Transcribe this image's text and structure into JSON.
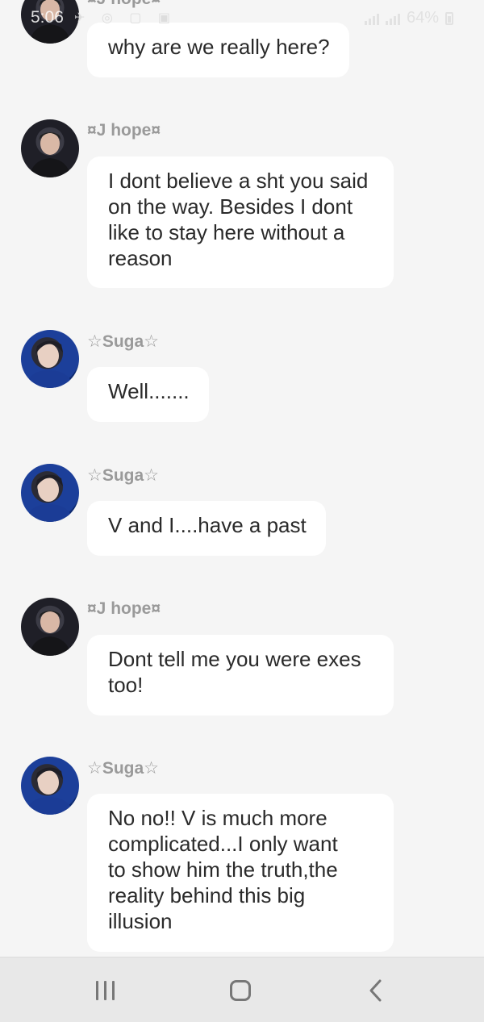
{
  "status_bar": {
    "time": "5:06",
    "battery": "64%",
    "left_icons": "✈ ◎ ▢ ▣",
    "star_glyph": "☆"
  },
  "top_partial_sender": "¤J hope¤",
  "messages": [
    {
      "sender": "¤J hope¤",
      "avatar": "jhope-avatar",
      "text": "why are we really here?"
    },
    {
      "sender": "¤J hope¤",
      "avatar": "jhope-avatar",
      "text": "I dont believe a sht you said\non the way. Besides I dont\nlike to stay here without a\nreason"
    },
    {
      "sender": "☆Suga☆",
      "avatar": "suga-avatar",
      "text": "Well......."
    },
    {
      "sender": "☆Suga☆",
      "avatar": "suga-avatar",
      "text": "V and I....have a past"
    },
    {
      "sender": "¤J hope¤",
      "avatar": "jhope-avatar",
      "text": "Dont tell me you were exes\ntoo!"
    },
    {
      "sender": "☆Suga☆",
      "avatar": "suga-avatar",
      "text": "No no!! V is much more\ncomplicated...I only want\nto show him the truth,the\nreality behind this big\nillusion"
    }
  ],
  "nav_bar": {
    "recents_icon": "recents-icon",
    "home_icon": "home-icon",
    "back_icon": "back-icon"
  },
  "colors": {
    "background": "#f5f5f5",
    "bubble": "#ffffff",
    "sender_text": "#9a9a9a",
    "message_text": "#2a2a2a",
    "nav_bar": "#e8e8e8"
  }
}
